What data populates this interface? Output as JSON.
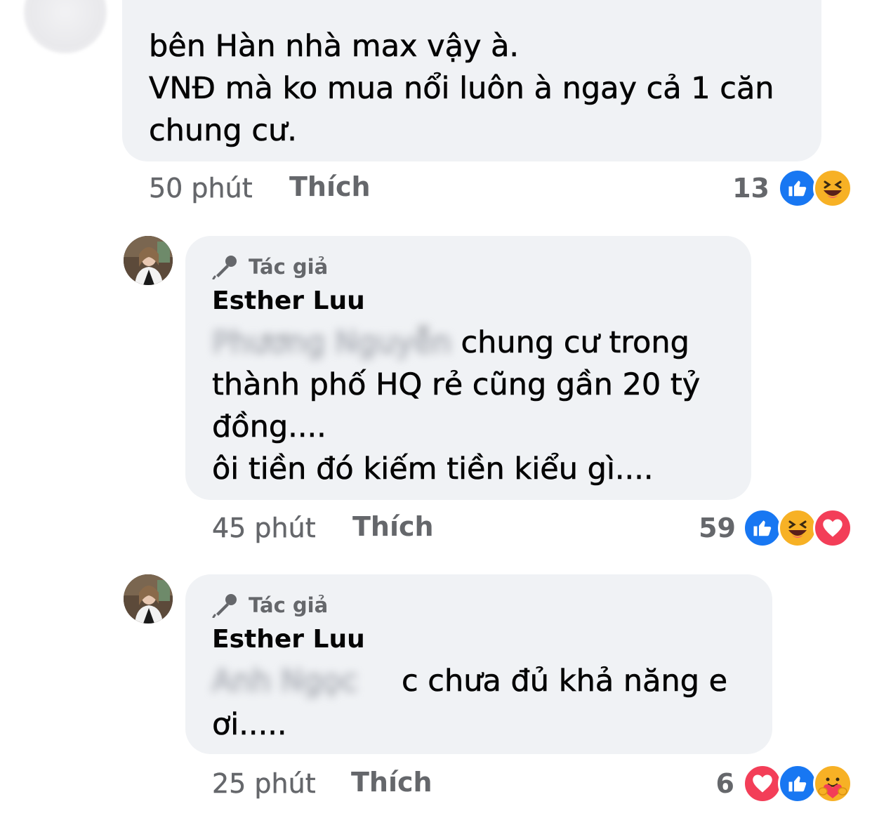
{
  "comments": [
    {
      "lines": "bên Hàn nhà max vậy à.\nVNĐ mà ko mua nổi luôn à ngay cả 1 căn\nchung cư.",
      "time": "50 phút",
      "like_label": "Thích",
      "reaction_count": "13",
      "reactions": [
        "like-icon",
        "haha-icon"
      ]
    },
    {
      "badge": "Tác giả",
      "author": "Esther Luu",
      "mention_blurred": "Phương Nguyễn",
      "first_line_rest": " chung cư trong",
      "rest_lines": "thành phố HQ rẻ cũng gần 20 tỷ\nđồng....\nôi tiền đó kiếm tiền kiểu gì....",
      "time": "45 phút",
      "like_label": "Thích",
      "reaction_count": "59",
      "reactions": [
        "like-icon",
        "haha-icon",
        "love-icon"
      ]
    },
    {
      "badge": "Tác giả",
      "author": "Esther Luu",
      "mention_blurred": "Anh Ngọc",
      "first_line_rest": "c chưa đủ khả năng e",
      "rest_lines": "ơi.....",
      "time": "25 phút",
      "like_label": "Thích",
      "reaction_count": "6",
      "reactions": [
        "love-icon",
        "like-icon",
        "care-icon"
      ]
    }
  ],
  "colors": {
    "bubble": "#f0f2f5",
    "text": "#050505",
    "meta": "#65676b",
    "like": "#1877f2",
    "haha": "#f7b125",
    "love": "#f33e58"
  }
}
